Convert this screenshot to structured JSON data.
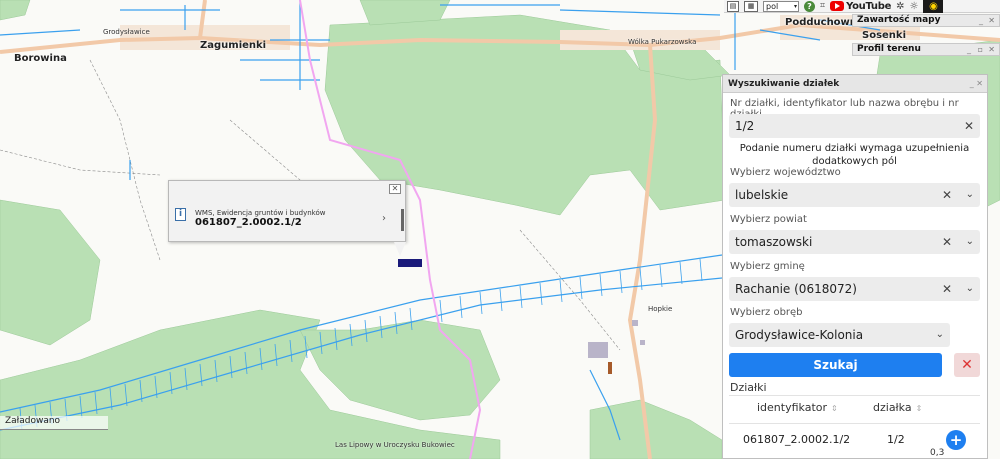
{
  "toolbar": {
    "language": "pol",
    "youtube": "YouTube",
    "panel_contents": "Zawartość mapy",
    "panel_profile": "Profil terenu"
  },
  "map": {
    "place_labels": [
      {
        "id": "borowina",
        "text": "Borowina"
      },
      {
        "id": "zagumienki",
        "text": "Zagumienki"
      },
      {
        "id": "grodyslawice",
        "text": "Grodysławice"
      },
      {
        "id": "wolka",
        "text": "Wólka Pukarzowska"
      },
      {
        "id": "podduchowne",
        "text": "Podduchowne"
      },
      {
        "id": "sosenki",
        "text": "Sosenki"
      },
      {
        "id": "hopkie",
        "text": "Hopkie"
      },
      {
        "id": "reserve",
        "text": "Las Lipowy w Uroczysku Bukowiec"
      }
    ]
  },
  "popup": {
    "source": "WMS, Ewidencja gruntów i budynków",
    "parcel_id": "061807_2.0002.1/2"
  },
  "status": "Załadowano",
  "panel": {
    "title": "Wyszukiwanie działek",
    "query_label": "Nr działki, identyfikator lub nazwa obrębu i nr działki",
    "query_value": "1/2",
    "hint": "Podanie numeru działki wymaga uzupełnienia dodatkowych pól",
    "voivodeship_label": "Wybierz województwo",
    "voivodeship_value": "lubelskie",
    "county_label": "Wybierz powiat",
    "county_value": "tomaszowski",
    "commune_label": "Wybierz gminę",
    "commune_value": "Rachanie (0618072)",
    "precinct_label": "Wybierz obręb",
    "precinct_value": "Grodysławice-Kolonia",
    "search_button": "Szukaj",
    "results_title": "Działki",
    "columns": [
      "identyfikator",
      "działka"
    ],
    "rows": [
      {
        "identyfikator": "061807_2.0002.1/2",
        "dzialka": "1/2"
      }
    ]
  },
  "scale_text": "0,3",
  "colors": {
    "forest": "#b9e0b4",
    "water": "#3aa0ee",
    "road": "#f2c9a8",
    "accent": "#1e7ff0",
    "gmina_border": "#f1a6f0"
  }
}
